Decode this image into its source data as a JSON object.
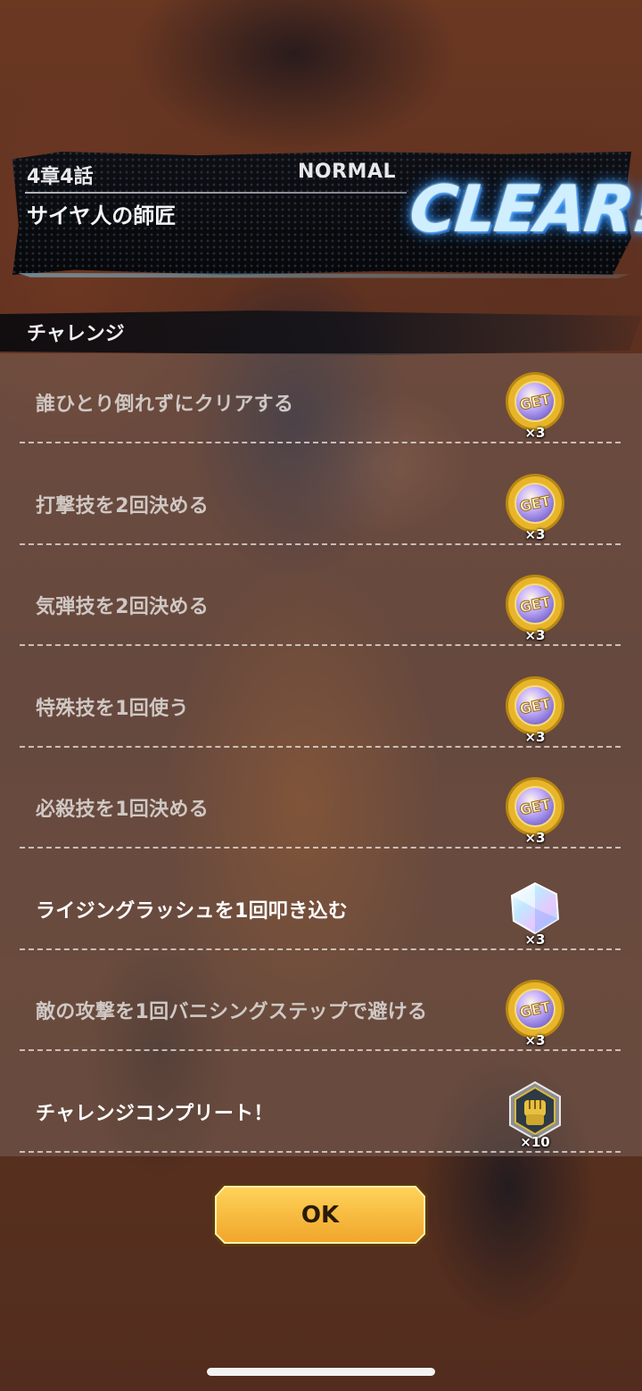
{
  "banner": {
    "chapter": "4章4話",
    "difficulty": "NORMAL",
    "stage_title": "サイヤ人の師匠",
    "result": "CLEAR!"
  },
  "challenge": {
    "section_title": "チャレンジ",
    "items": [
      {
        "label": "誰ひとり倒れずにクリアする",
        "reward_icon": "get-medal-icon",
        "reward_count": "×3",
        "state": "done"
      },
      {
        "label": "打撃技を2回決める",
        "reward_icon": "get-medal-icon",
        "reward_count": "×3",
        "state": "done"
      },
      {
        "label": "気弾技を2回決める",
        "reward_icon": "get-medal-icon",
        "reward_count": "×3",
        "state": "done"
      },
      {
        "label": "特殊技を1回使う",
        "reward_icon": "get-medal-icon",
        "reward_count": "×3",
        "state": "done"
      },
      {
        "label": "必殺技を1回決める",
        "reward_icon": "get-medal-icon",
        "reward_count": "×3",
        "state": "done"
      },
      {
        "label": "ライジングラッシュを1回叩き込む",
        "reward_icon": "chrono-crystal-icon",
        "reward_count": "×3",
        "state": "new"
      },
      {
        "label": "敵の攻撃を1回バニシングステップで避ける",
        "reward_icon": "get-medal-icon",
        "reward_count": "×3",
        "state": "done"
      },
      {
        "label": "チャレンジコンプリート！",
        "reward_icon": "fist-emblem-icon",
        "reward_count": "×10",
        "state": "new"
      }
    ]
  },
  "ok_button": {
    "label": "OK"
  },
  "colors": {
    "clear_glow": "#5ab8ff",
    "button_gold": "#f2b531",
    "medal_gold": "#e8b52a"
  }
}
